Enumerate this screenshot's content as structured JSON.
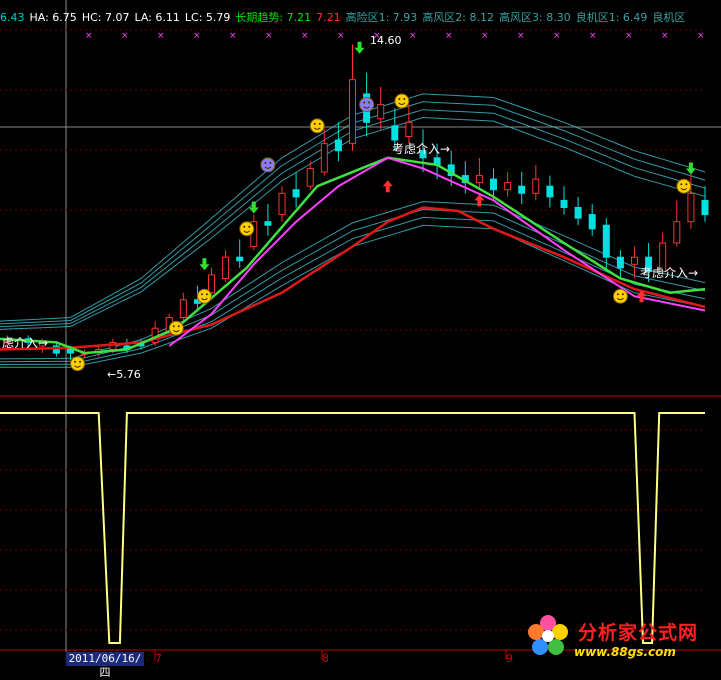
{
  "header": {
    "items": [
      {
        "text": "6.43",
        "color": "#00c8c8"
      },
      {
        "text": "HA: 6.75",
        "color": "#ffffff"
      },
      {
        "text": "HC: 7.07",
        "color": "#ffffff"
      },
      {
        "text": "LA: 6.11",
        "color": "#ffffff"
      },
      {
        "text": "LC: 5.79",
        "color": "#ffffff"
      },
      {
        "text": "长期趋势: 7.21",
        "color": "#00e000"
      },
      {
        "text": "7.21",
        "color": "#ff3030"
      },
      {
        "text": "高险区1: 7.93",
        "color": "#3aa0a0"
      },
      {
        "text": "高风区2: 8.12",
        "color": "#3aa0a0"
      },
      {
        "text": "高风区3: 8.30",
        "color": "#3aa0a0"
      },
      {
        "text": "良机区1: 6.49",
        "color": "#3aa0a0"
      },
      {
        "text": "良机区",
        "color": "#3aa0a0"
      }
    ]
  },
  "annotations": {
    "high_price": "14.60",
    "low_price": "←5.76",
    "consider_entry": "考虑介入→",
    "consider_entry_left": "虑介入→"
  },
  "axis": {
    "cursor_date": "2011/06/16/四",
    "month_ticks": [
      {
        "label": "7"
      },
      {
        "label": "8"
      },
      {
        "label": "9"
      }
    ]
  },
  "watermark": {
    "title": "分析家公式网",
    "url": "www.88gs.com"
  },
  "colors": {
    "background": "#000000",
    "up_candle": "#ff3030",
    "down_candle": "#00e0e0",
    "long_trend": "#e01818",
    "mid_trend": "#40e040",
    "short_trend": "#ff40ff",
    "bands": "#40c0d0",
    "lower_signal": "#ffff80"
  },
  "chart_data": [
    {
      "type": "line",
      "panel": "main",
      "xlabel": "",
      "ylabel": "",
      "ylim": [
        5.0,
        15.0
      ],
      "x_range": [
        0,
        100
      ],
      "series": [
        {
          "key": "long",
          "values": [
            [
              0,
              6.0
            ],
            [
              10,
              6.05
            ],
            [
              20,
              6.2
            ],
            [
              30,
              6.7
            ],
            [
              40,
              7.6
            ],
            [
              50,
              8.9
            ],
            [
              55,
              9.6
            ],
            [
              60,
              10.0
            ],
            [
              65,
              9.9
            ],
            [
              70,
              9.4
            ],
            [
              80,
              8.6
            ],
            [
              90,
              7.7
            ],
            [
              100,
              7.2
            ]
          ]
        },
        {
          "key": "mid",
          "values": [
            [
              0,
              6.3
            ],
            [
              8,
              6.2
            ],
            [
              12,
              5.9
            ],
            [
              18,
              6.0
            ],
            [
              25,
              6.6
            ],
            [
              35,
              8.3
            ],
            [
              45,
              10.6
            ],
            [
              55,
              11.4
            ],
            [
              62,
              11.2
            ],
            [
              70,
              10.3
            ],
            [
              80,
              9.0
            ],
            [
              88,
              8.0
            ],
            [
              95,
              7.6
            ],
            [
              100,
              7.7
            ]
          ]
        },
        {
          "key": "short",
          "values": [
            [
              24,
              6.1
            ],
            [
              30,
              7.0
            ],
            [
              36,
              8.4
            ],
            [
              42,
              9.6
            ],
            [
              48,
              10.6
            ],
            [
              55,
              11.4
            ],
            [
              60,
              11.1
            ],
            [
              70,
              10.2
            ],
            [
              80,
              8.8
            ],
            [
              90,
              7.5
            ],
            [
              100,
              7.1
            ]
          ]
        },
        {
          "key": "band_top",
          "values": [
            [
              0,
              6.8
            ],
            [
              10,
              6.9
            ],
            [
              20,
              8.0
            ],
            [
              30,
              9.7
            ],
            [
              40,
              11.4
            ],
            [
              50,
              12.6
            ],
            [
              60,
              13.2
            ],
            [
              70,
              13.1
            ],
            [
              80,
              12.4
            ],
            [
              90,
              11.6
            ],
            [
              100,
              11.0
            ]
          ]
        },
        {
          "key": "band_bottom",
          "values": [
            [
              0,
              5.5
            ],
            [
              10,
              5.5
            ],
            [
              20,
              5.9
            ],
            [
              30,
              6.6
            ],
            [
              40,
              7.8
            ],
            [
              50,
              8.9
            ],
            [
              60,
              9.5
            ],
            [
              70,
              9.4
            ],
            [
              80,
              8.5
            ],
            [
              90,
              7.6
            ],
            [
              100,
              7.2
            ]
          ]
        }
      ],
      "candles": [
        [
          1,
          6.2,
          6.3,
          6.0,
          6.4
        ],
        [
          4,
          6.3,
          6.2,
          6.0,
          6.4
        ],
        [
          6,
          6.1,
          6.2,
          5.9,
          6.3
        ],
        [
          8,
          6.1,
          5.9,
          5.8,
          6.2
        ],
        [
          10,
          6.0,
          5.9,
          5.7,
          6.1
        ],
        [
          12,
          5.9,
          5.9,
          5.76,
          6.0
        ],
        [
          14,
          5.9,
          6.0,
          5.8,
          6.1
        ],
        [
          16,
          6.0,
          6.2,
          5.9,
          6.3
        ],
        [
          18,
          6.1,
          6.0,
          5.9,
          6.3
        ],
        [
          20,
          6.2,
          6.1,
          6.0,
          6.3
        ],
        [
          22,
          6.2,
          6.6,
          6.1,
          6.8
        ],
        [
          24,
          6.5,
          6.9,
          6.4,
          7.0
        ],
        [
          26,
          6.9,
          7.4,
          6.8,
          7.6
        ],
        [
          28,
          7.4,
          7.3,
          7.1,
          7.8
        ],
        [
          30,
          7.6,
          8.1,
          7.4,
          8.3
        ],
        [
          32,
          8.0,
          8.6,
          7.9,
          8.8
        ],
        [
          34,
          8.6,
          8.5,
          8.3,
          9.1
        ],
        [
          36,
          8.9,
          9.6,
          8.8,
          9.8
        ],
        [
          38,
          9.6,
          9.5,
          9.2,
          10.1
        ],
        [
          40,
          9.8,
          10.4,
          9.6,
          10.6
        ],
        [
          42,
          10.5,
          10.3,
          10.0,
          11.0
        ],
        [
          44,
          10.6,
          11.1,
          10.5,
          11.3
        ],
        [
          46,
          11.0,
          11.8,
          10.9,
          12.2
        ],
        [
          48,
          11.9,
          11.6,
          11.3,
          12.4
        ],
        [
          50,
          11.8,
          13.6,
          11.6,
          14.6
        ],
        [
          52,
          13.2,
          12.4,
          12.0,
          13.8
        ],
        [
          54,
          12.5,
          12.9,
          12.2,
          13.4
        ],
        [
          56,
          12.3,
          11.9,
          11.6,
          12.8
        ],
        [
          58,
          12.0,
          12.4,
          11.8,
          12.9
        ],
        [
          60,
          11.6,
          11.4,
          11.0,
          12.2
        ],
        [
          62,
          11.4,
          11.2,
          10.8,
          11.8
        ],
        [
          64,
          11.2,
          10.9,
          10.6,
          11.6
        ],
        [
          66,
          10.9,
          10.7,
          10.4,
          11.3
        ],
        [
          68,
          10.7,
          10.9,
          10.5,
          11.4
        ],
        [
          70,
          10.8,
          10.5,
          10.2,
          11.1
        ],
        [
          72,
          10.5,
          10.7,
          10.3,
          11.0
        ],
        [
          74,
          10.6,
          10.4,
          10.1,
          11.0
        ],
        [
          76,
          10.4,
          10.8,
          10.2,
          11.2
        ],
        [
          78,
          10.6,
          10.3,
          10.0,
          10.9
        ],
        [
          80,
          10.2,
          10.0,
          9.8,
          10.6
        ],
        [
          82,
          10.0,
          9.7,
          9.5,
          10.3
        ],
        [
          84,
          9.8,
          9.4,
          9.2,
          10.1
        ],
        [
          86,
          9.5,
          8.6,
          8.2,
          9.7
        ],
        [
          88,
          8.6,
          8.3,
          8.0,
          8.8
        ],
        [
          90,
          8.4,
          8.6,
          8.0,
          8.9
        ],
        [
          92,
          8.6,
          8.2,
          7.9,
          9.0
        ],
        [
          94,
          8.2,
          9.0,
          8.1,
          9.3
        ],
        [
          96,
          9.0,
          9.6,
          8.9,
          10.2
        ],
        [
          98,
          9.6,
          10.4,
          9.4,
          11.0
        ],
        [
          100,
          10.2,
          9.8,
          9.6,
          10.6
        ]
      ]
    },
    {
      "type": "line",
      "panel": "lower",
      "ylim": [
        0,
        1
      ],
      "series": [
        {
          "key": "signal",
          "values": [
            [
              0,
              1
            ],
            [
              14,
              1
            ],
            [
              15.5,
              0
            ],
            [
              17,
              0
            ],
            [
              18,
              1
            ],
            [
              90,
              1
            ],
            [
              91.2,
              0
            ],
            [
              92.5,
              0
            ],
            [
              93.5,
              1
            ],
            [
              100,
              1
            ]
          ]
        }
      ]
    }
  ]
}
